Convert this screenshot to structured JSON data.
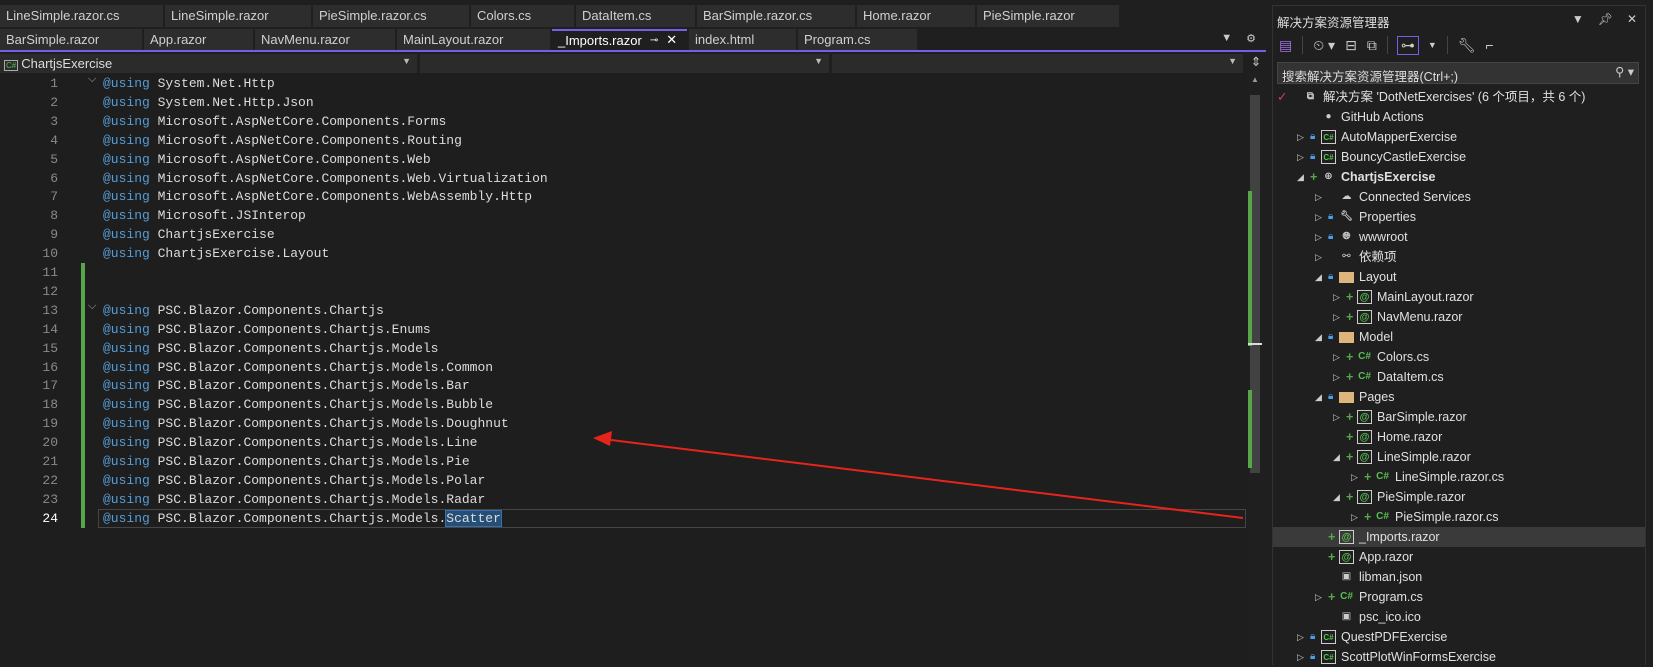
{
  "tabs_row1": [
    "LineSimple.razor.cs",
    "LineSimple.razor",
    "PieSimple.razor.cs",
    "Colors.cs",
    "DataItem.cs",
    "BarSimple.razor.cs",
    "Home.razor",
    "PieSimple.razor"
  ],
  "tabs_row2": [
    "BarSimple.razor",
    "App.razor",
    "NavMenu.razor",
    "MainLayout.razor",
    "_Imports.razor",
    "index.html",
    "Program.cs"
  ],
  "active_tab": "_Imports.razor",
  "nav": {
    "project": "ChartjsExercise",
    "project_icon": "C#",
    "middle": "",
    "right": ""
  },
  "code": {
    "keyword": "@using",
    "lines": [
      "System.Net.Http",
      "System.Net.Http.Json",
      "Microsoft.AspNetCore.Components.Forms",
      "Microsoft.AspNetCore.Components.Routing",
      "Microsoft.AspNetCore.Components.Web",
      "Microsoft.AspNetCore.Components.Web.Virtualization",
      "Microsoft.AspNetCore.Components.WebAssembly.Http",
      "Microsoft.JSInterop",
      "ChartjsExercise",
      "ChartjsExercise.Layout",
      "",
      "",
      "PSC.Blazor.Components.Chartjs",
      "PSC.Blazor.Components.Chartjs.Enums",
      "PSC.Blazor.Components.Chartjs.Models",
      "PSC.Blazor.Components.Chartjs.Models.Common",
      "PSC.Blazor.Components.Chartjs.Models.Bar",
      "PSC.Blazor.Components.Chartjs.Models.Bubble",
      "PSC.Blazor.Components.Chartjs.Models.Doughnut",
      "PSC.Blazor.Components.Chartjs.Models.Line",
      "PSC.Blazor.Components.Chartjs.Models.Pie",
      "PSC.Blazor.Components.Chartjs.Models.Polar",
      "PSC.Blazor.Components.Chartjs.Models.Radar",
      "PSC.Blazor.Components.Chartjs.Models."
    ],
    "selected_word": "Scatter",
    "current_line": 24
  },
  "explorer": {
    "title": "解决方案资源管理器",
    "search_placeholder": "搜索解决方案资源管理器(Ctrl+;)",
    "tree": [
      {
        "label": "解决方案 'DotNetExercises' (6 个项目，共 6 个)",
        "level": 0,
        "exp": "",
        "icon": "sln"
      },
      {
        "label": "GitHub Actions",
        "level": 1,
        "exp": "",
        "icon": "github"
      },
      {
        "label": "AutoMapperExercise",
        "level": 1,
        "exp": "closed",
        "lock": true,
        "icon": "proj"
      },
      {
        "label": "BouncyCastleExercise",
        "level": 1,
        "exp": "closed",
        "lock": true,
        "icon": "proj"
      },
      {
        "label": "ChartjsExercise",
        "level": 1,
        "exp": "open",
        "plus": true,
        "icon": "web",
        "bold": true
      },
      {
        "label": "Connected Services",
        "level": 2,
        "exp": "closed",
        "icon": "cloud"
      },
      {
        "label": "Properties",
        "level": 2,
        "exp": "closed",
        "lock": true,
        "icon": "props"
      },
      {
        "label": "wwwroot",
        "level": 2,
        "exp": "closed",
        "lock": true,
        "icon": "globe"
      },
      {
        "label": "依赖项",
        "level": 2,
        "exp": "closed",
        "icon": "deps"
      },
      {
        "label": "Layout",
        "level": 2,
        "exp": "open",
        "lock": true,
        "icon": "folder"
      },
      {
        "label": "MainLayout.razor",
        "level": 3,
        "exp": "closed",
        "plus": true,
        "icon": "razor"
      },
      {
        "label": "NavMenu.razor",
        "level": 3,
        "exp": "closed",
        "plus": true,
        "icon": "razor"
      },
      {
        "label": "Model",
        "level": 2,
        "exp": "open",
        "lock": true,
        "icon": "folder"
      },
      {
        "label": "Colors.cs",
        "level": 3,
        "exp": "closed",
        "plus": true,
        "icon": "cs"
      },
      {
        "label": "DataItem.cs",
        "level": 3,
        "exp": "closed",
        "plus": true,
        "icon": "cs"
      },
      {
        "label": "Pages",
        "level": 2,
        "exp": "open",
        "lock": true,
        "icon": "folder"
      },
      {
        "label": "BarSimple.razor",
        "level": 3,
        "exp": "closed",
        "plus": true,
        "icon": "razor"
      },
      {
        "label": "Home.razor",
        "level": 3,
        "exp": "",
        "plus": true,
        "icon": "razor"
      },
      {
        "label": "LineSimple.razor",
        "level": 3,
        "exp": "open",
        "plus": true,
        "icon": "razor"
      },
      {
        "label": "LineSimple.razor.cs",
        "level": 4,
        "exp": "closed",
        "plus": true,
        "icon": "cs"
      },
      {
        "label": "PieSimple.razor",
        "level": 3,
        "exp": "open",
        "plus": true,
        "icon": "razor"
      },
      {
        "label": "PieSimple.razor.cs",
        "level": 4,
        "exp": "closed",
        "plus": true,
        "icon": "cs"
      },
      {
        "label": "_Imports.razor",
        "level": 2,
        "exp": "",
        "plus": true,
        "icon": "razor",
        "selected": true
      },
      {
        "label": "App.razor",
        "level": 2,
        "exp": "",
        "plus": true,
        "icon": "razor"
      },
      {
        "label": "libman.json",
        "level": 2,
        "exp": "",
        "icon": "file"
      },
      {
        "label": "Program.cs",
        "level": 2,
        "exp": "closed",
        "plus": true,
        "icon": "cs"
      },
      {
        "label": "psc_ico.ico",
        "level": 2,
        "exp": "",
        "icon": "file"
      },
      {
        "label": "QuestPDFExercise",
        "level": 1,
        "exp": "closed",
        "lock": true,
        "icon": "proj"
      },
      {
        "label": "ScottPlotWinFormsExercise",
        "level": 1,
        "exp": "closed",
        "lock": true,
        "icon": "proj"
      }
    ]
  },
  "colors": {
    "accent": "#7160e8",
    "keyword": "#569cd6",
    "change_bar": "#57a64a",
    "arrow": "#e8231c"
  }
}
